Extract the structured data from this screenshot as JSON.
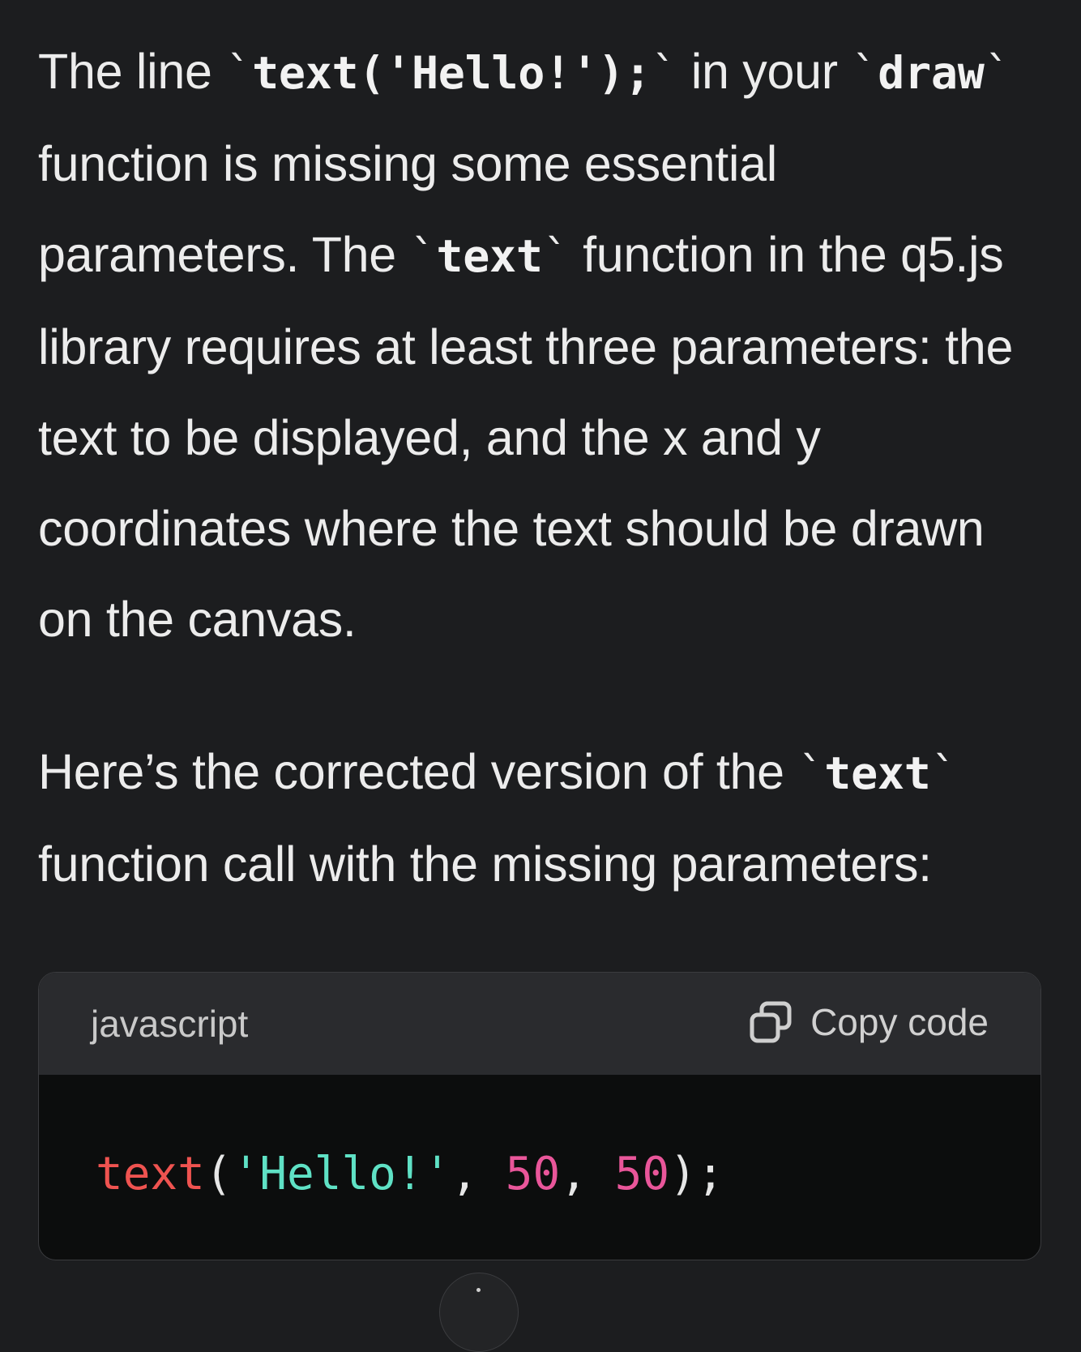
{
  "message": {
    "para1": {
      "t1": "The line ",
      "code1": "text('Hello!');",
      "t2": " in your ",
      "code2": "draw",
      "t3": " function is missing some essential parameters. The ",
      "code3": "text",
      "t4": " function in the q5.js library requires at least three parameters: the text to be displayed, and the x and y coordinates where the text should be drawn on the canvas."
    },
    "para2": {
      "t1": "Here’s the corrected version of the ",
      "code1": "text",
      "t2": " function call with the missing parameters:"
    }
  },
  "code_block": {
    "language": "javascript",
    "copy_label": "Copy code",
    "copy_icon": "copy-icon",
    "tokens": {
      "fn": "text",
      "open_paren": "(",
      "string": "'Hello!'",
      "comma1": ", ",
      "num1": "50",
      "comma2": ", ",
      "num2": "50",
      "close": ");"
    }
  },
  "colors": {
    "background": "#1c1d1f",
    "code_header": "#2a2b2e",
    "code_body": "#0c0d0d",
    "token_function": "#ef5350",
    "token_string": "#5fe1c5",
    "token_number": "#e9569a"
  }
}
